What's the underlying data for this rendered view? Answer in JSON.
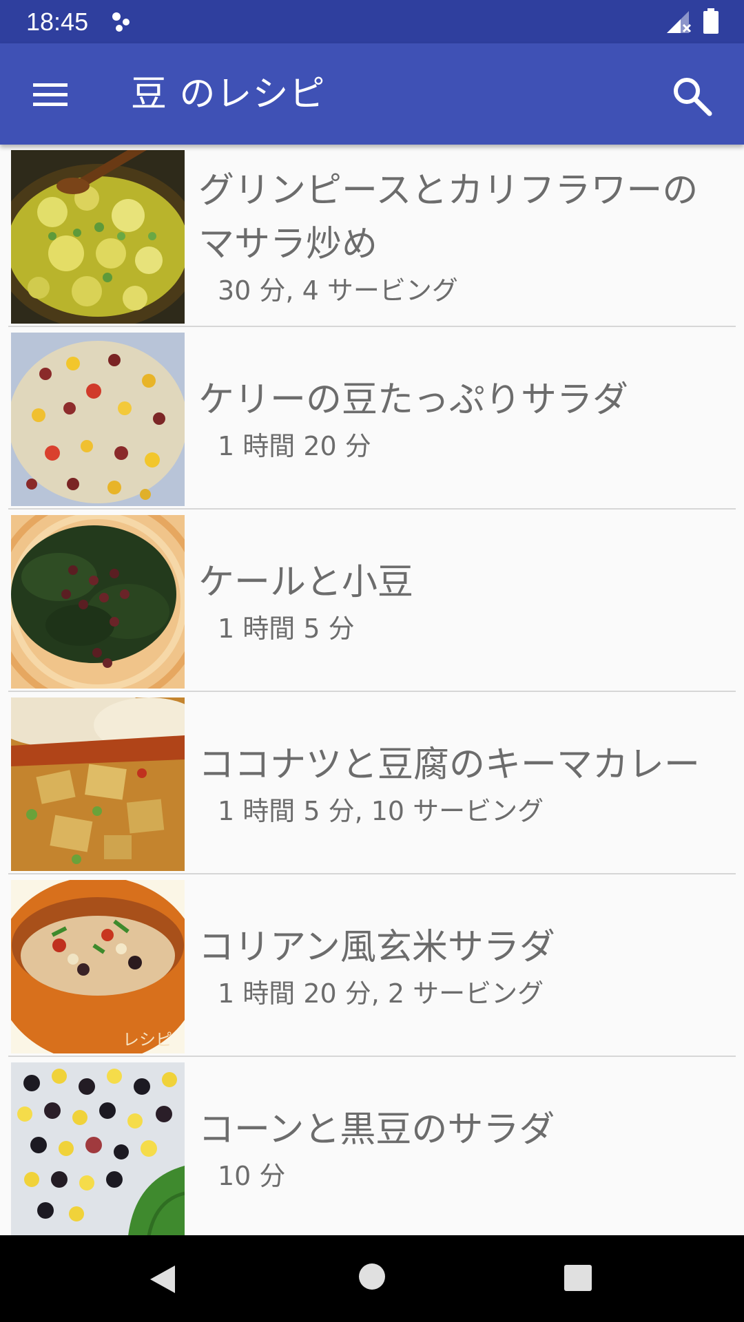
{
  "status_bar": {
    "time": "18:45",
    "icons": [
      "notification-dots-icon",
      "signal-no-data-icon",
      "battery-icon"
    ]
  },
  "app_bar": {
    "title": "豆 のレシピ",
    "menu_icon": "hamburger-menu-icon",
    "search_icon": "search-icon",
    "color": "#3f51b5",
    "status_color": "#2f3f9e"
  },
  "recipes": [
    {
      "title": "グリンピースとカリフラワーのマサラ炒め",
      "meta": "30 分, 4 サービング"
    },
    {
      "title": "ケリーの豆たっぷりサラダ",
      "meta": "1 時間 20 分"
    },
    {
      "title": "ケールと小豆",
      "meta": "1 時間 5 分"
    },
    {
      "title": "ココナツと豆腐のキーマカレー",
      "meta": "1 時間 5 分, 10 サービング"
    },
    {
      "title": "コリアン風玄米サラダ",
      "meta": "1 時間 20 分, 2 サービング"
    },
    {
      "title": "コーンと黒豆のサラダ",
      "meta": "10 分"
    }
  ],
  "thumbnail_watermark": "レシピ",
  "nav_bar": {
    "icons": [
      "back-icon",
      "home-icon",
      "recent-apps-icon"
    ]
  }
}
